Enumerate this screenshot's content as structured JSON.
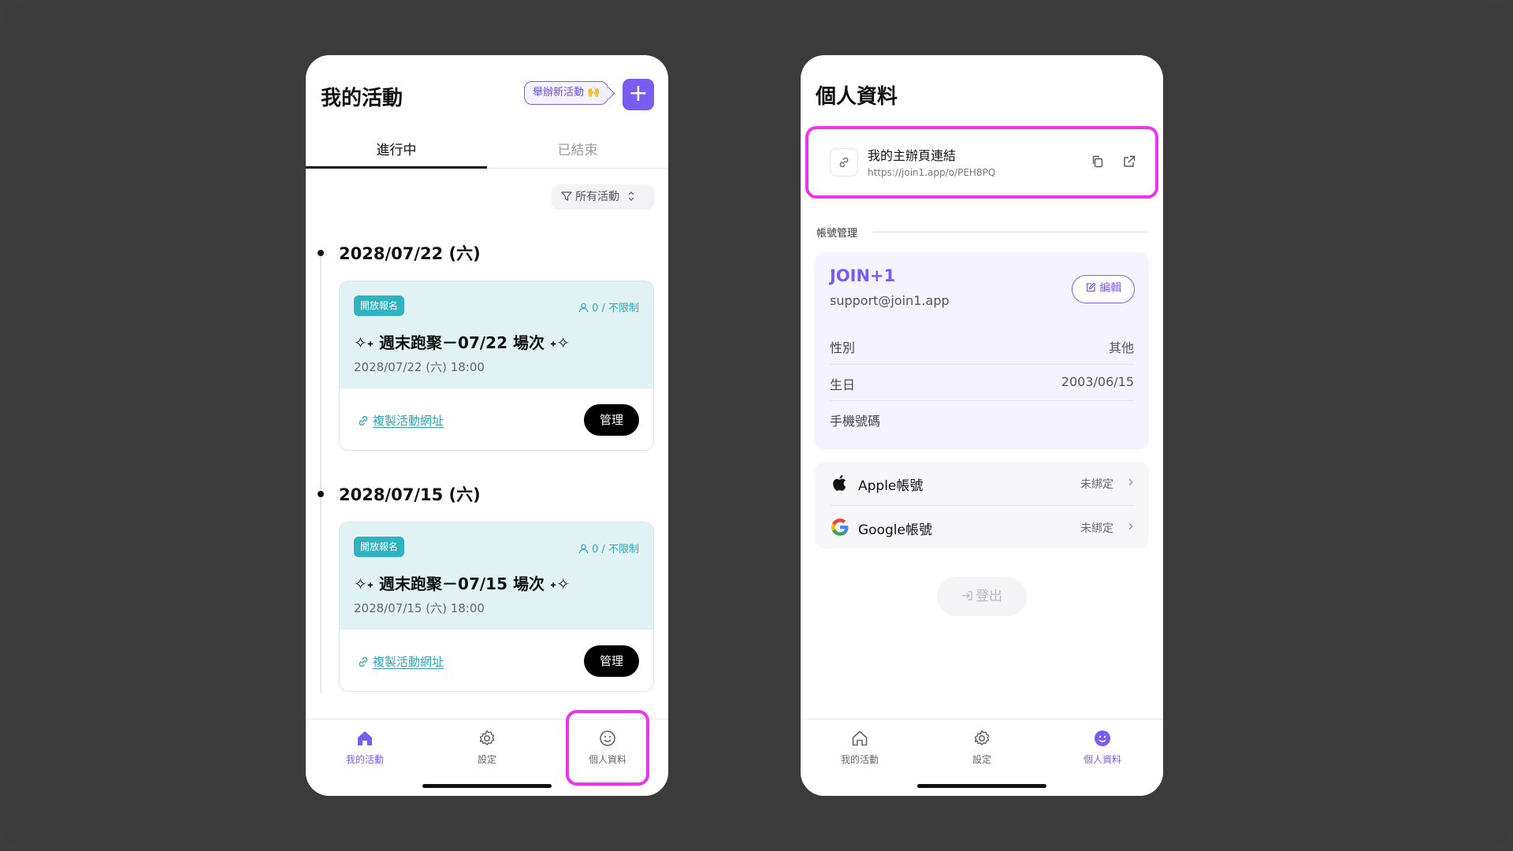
{
  "left": {
    "title": "我的活動",
    "host_prompt": "舉辦新活動 🙌",
    "add_label": "+",
    "tabs": [
      "進行中",
      "已結束"
    ],
    "filter_label": "所有活動",
    "events": [
      {
        "date": "2028/07/22 (六)",
        "badge": "開放報名",
        "capacity": "0 / 不限制",
        "title": "✧˖ 週末跑聚－07/22 場次 ˖✧",
        "time": "2028/07/22 (六) 18:00",
        "copy_link": "複製活動網址",
        "manage": "管理"
      },
      {
        "date": "2028/07/15 (六)",
        "badge": "開放報名",
        "capacity": "0 / 不限制",
        "title": "✧˖ 週末跑聚－07/15 場次 ˖✧",
        "time": "2028/07/15 (六) 18:00",
        "copy_link": "複製活動網址",
        "manage": "管理"
      }
    ],
    "tabbar": [
      "我的活動",
      "設定",
      "個人資料"
    ]
  },
  "right": {
    "title": "個人資料",
    "link_title": "我的主辦頁連結",
    "link_url": "https://join1.app/o/PEH8PQ",
    "section": "帳號管理",
    "brand": "JOIN+1",
    "email": "support@join1.app",
    "edit": "編輯",
    "fields": [
      {
        "label": "性別",
        "value": "其他"
      },
      {
        "label": "生日",
        "value": "2003/06/15"
      },
      {
        "label": "手機號碼",
        "value": ""
      }
    ],
    "bindings": [
      {
        "label": "Apple帳號",
        "status": "未綁定"
      },
      {
        "label": "Google帳號",
        "status": "未綁定"
      }
    ],
    "logout": "登出",
    "tabbar": [
      "我的活動",
      "設定",
      "個人資料"
    ]
  },
  "colors": {
    "accent": "#7b5cf0",
    "teal": "#2aa8ba",
    "highlight": "#ee33ee"
  },
  "icons": [
    "plus-icon",
    "filter-icon",
    "sort-icon",
    "person-icon",
    "link-icon",
    "copy-icon",
    "external-link-icon",
    "edit-icon",
    "apple-icon",
    "google-icon",
    "chevron-right-icon",
    "logout-icon",
    "home-icon",
    "gear-icon",
    "smile-icon"
  ]
}
